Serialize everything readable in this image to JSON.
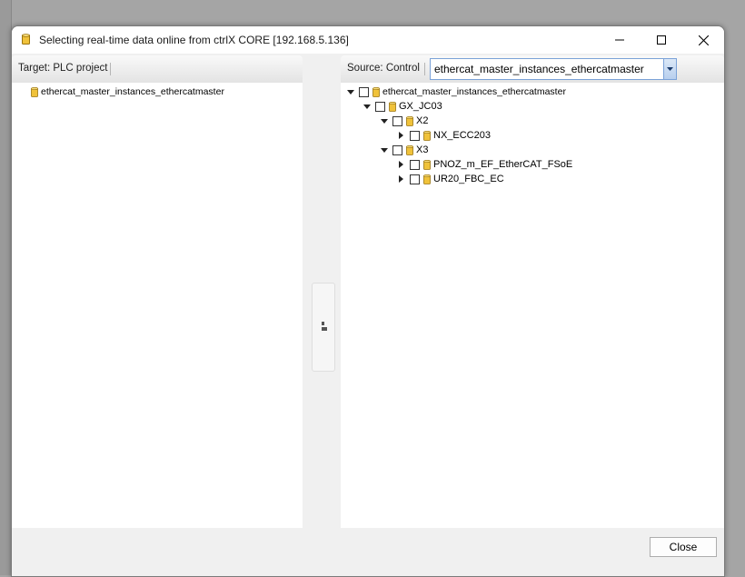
{
  "window": {
    "title": "Selecting real-time data online from ctrlX CORE [192.168.5.136]",
    "title_icon": "database-icon"
  },
  "target_panel": {
    "label": "Target: PLC project",
    "tree": [
      {
        "label": "ethercat_master_instances_ethercatmaster",
        "icon": "database-icon"
      }
    ]
  },
  "source_panel": {
    "label": "Source: Control",
    "dropdown": {
      "selected": "ethercat_master_instances_ethercatmaster"
    },
    "tree": [
      {
        "label": "ethercat_master_instances_ethercatmaster",
        "expanded": true
      },
      {
        "label": "GX_JC03",
        "expanded": true
      },
      {
        "label": "X2",
        "expanded": true
      },
      {
        "label": "NX_ECC203",
        "expanded": false
      },
      {
        "label": "X3",
        "expanded": true
      },
      {
        "label": "PNOZ_m_EF_EtherCAT_FSoE",
        "expanded": false
      },
      {
        "label": "UR20_FBC_EC",
        "expanded": false
      }
    ]
  },
  "footer": {
    "close_label": "Close"
  },
  "colors": {
    "accent": "#7ba2d8",
    "db_icon": "#e8b520"
  }
}
